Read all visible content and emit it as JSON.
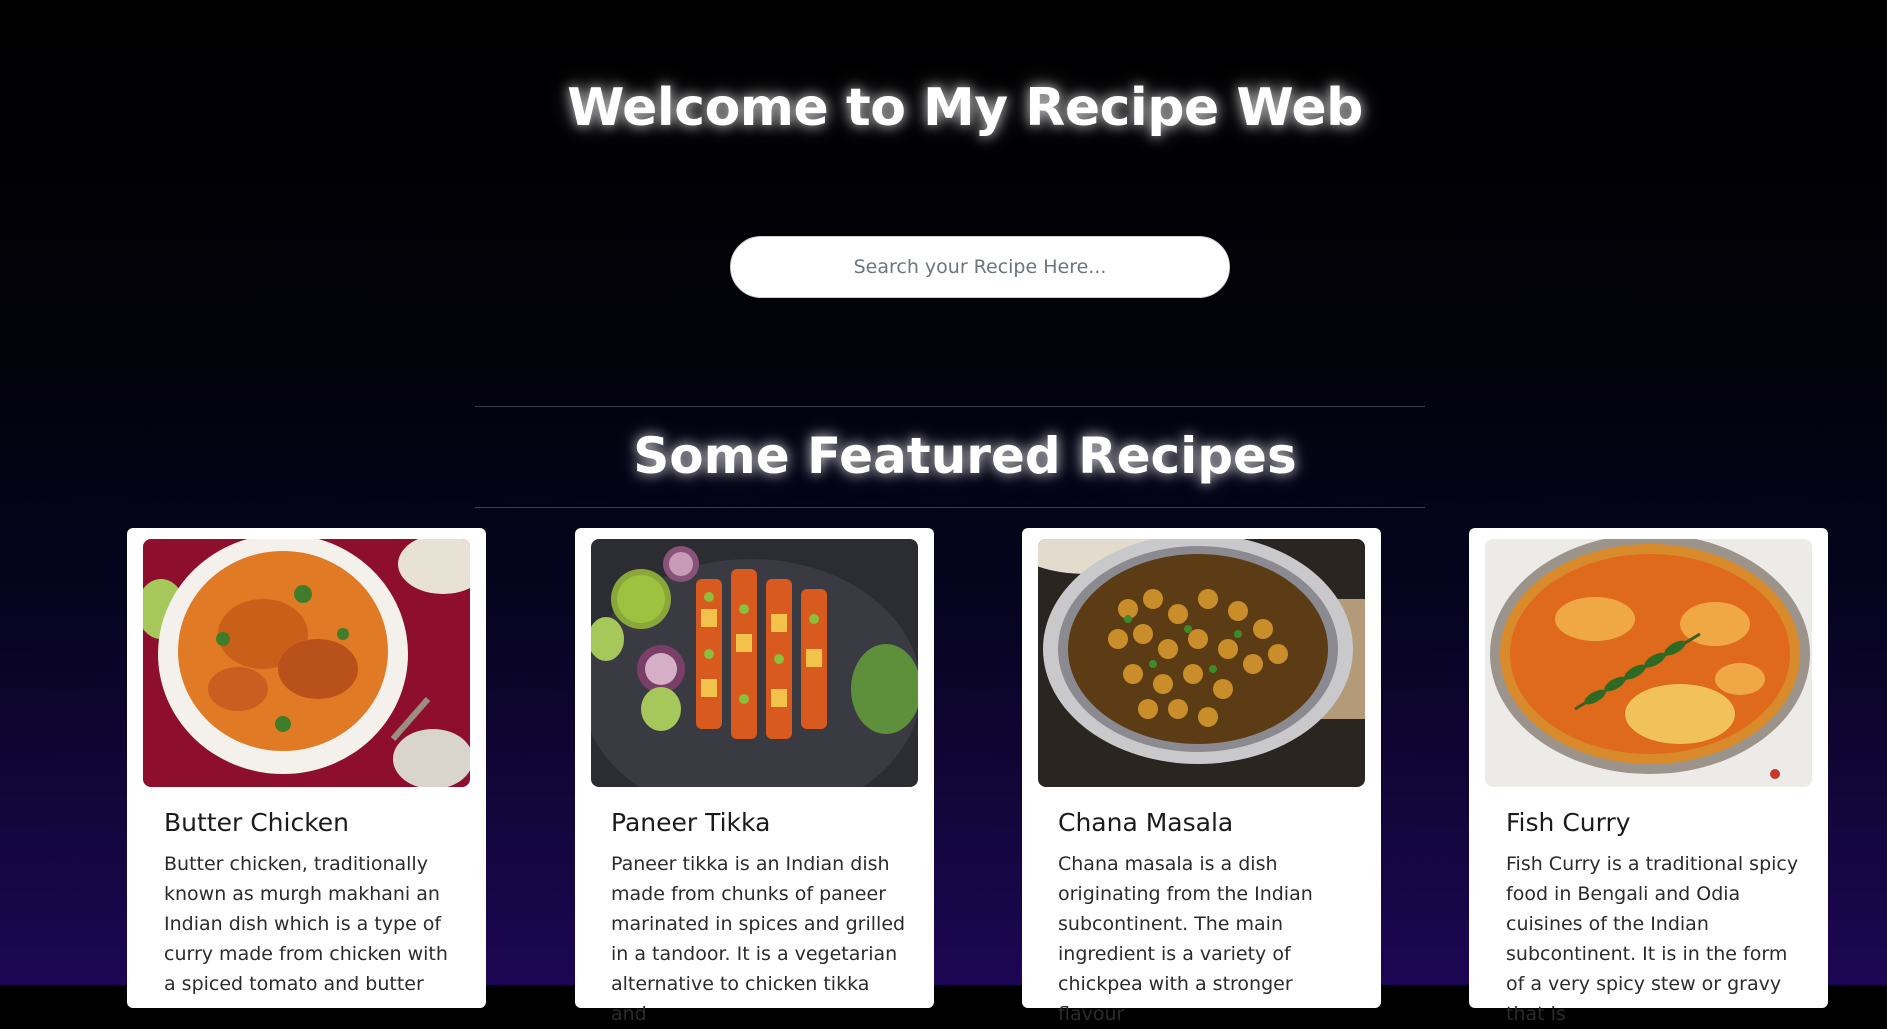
{
  "hero": {
    "title": "Welcome to My Recipe Web"
  },
  "search": {
    "placeholder": "Search your Recipe Here..."
  },
  "featured": {
    "title": "Some Featured Recipes"
  },
  "recipes": [
    {
      "title": "Butter Chicken",
      "description": "Butter chicken, traditionally known as murgh makhani an Indian dish which is a type of curry made from chicken with a spiced tomato and butter",
      "image_icon": "butter-chicken-photo"
    },
    {
      "title": "Paneer Tikka",
      "description": "Paneer tikka is an Indian dish made from chunks of paneer marinated in spices and grilled in a tandoor. It is a vegetarian alternative to chicken tikka and",
      "image_icon": "paneer-tikka-photo"
    },
    {
      "title": "Chana Masala",
      "description": "Chana masala is a dish originating from the Indian subcontinent. The main ingredient is a variety of chickpea with a stronger flavour",
      "image_icon": "chana-masala-photo"
    },
    {
      "title": "Fish Curry",
      "description": "Fish Curry is a traditional spicy food in Bengali and Odia cuisines of the Indian subcontinent. It is in the form of a very spicy stew or gravy that is",
      "image_icon": "fish-curry-photo"
    }
  ],
  "colors": {
    "background_top": "#000000",
    "background_bottom": "#1d0654",
    "card": "#ffffff"
  }
}
